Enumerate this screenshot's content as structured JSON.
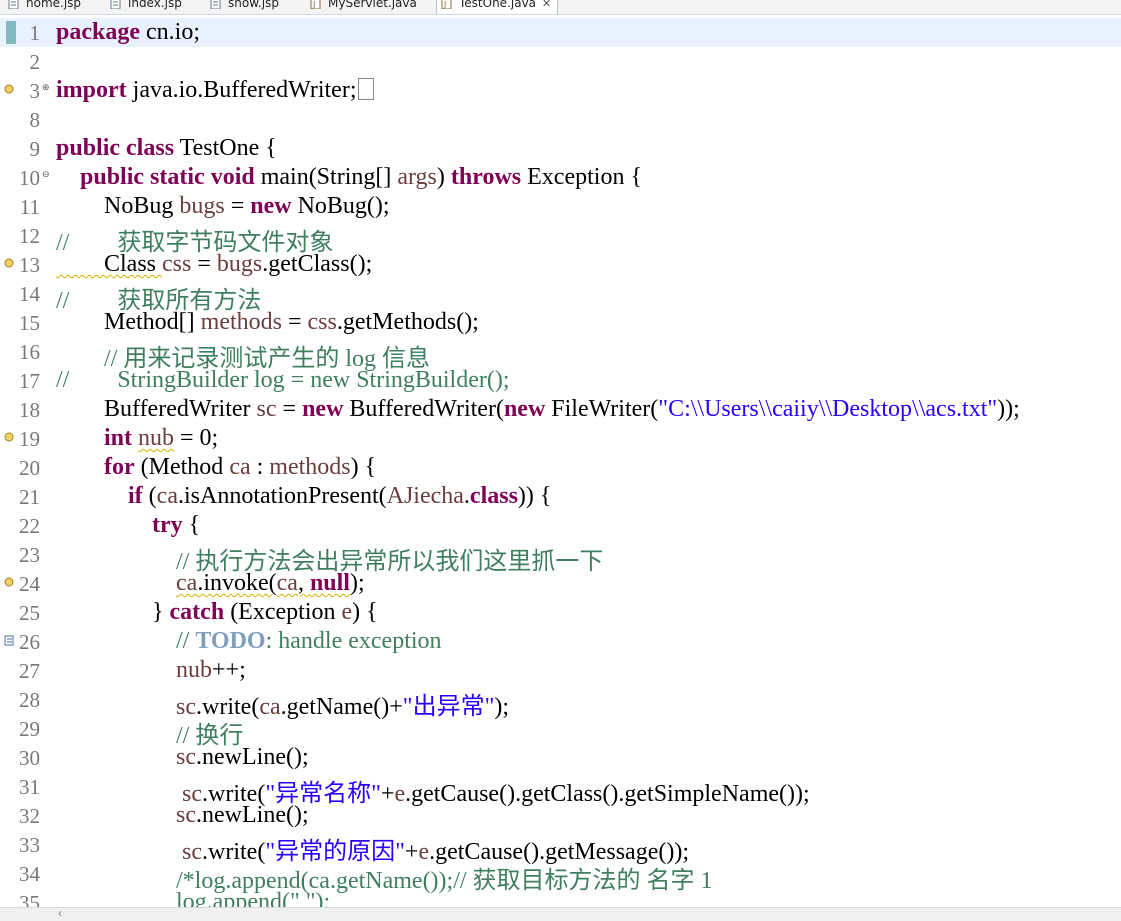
{
  "tabs": [
    {
      "label": "home.jsp",
      "icon": "jsp-file-icon"
    },
    {
      "label": "index.jsp",
      "icon": "jsp-file-icon"
    },
    {
      "label": "show.jsp",
      "icon": "jsp-file-icon"
    },
    {
      "label": "MyServlet.java",
      "icon": "java-file-icon"
    },
    {
      "label": "TestOne.java",
      "icon": "java-file-icon",
      "active": true,
      "close": "✕"
    }
  ],
  "line_numbers": [
    "1",
    "2",
    "3",
    "8",
    "9",
    "10",
    "11",
    "12",
    "13",
    "14",
    "15",
    "16",
    "17",
    "18",
    "19",
    "20",
    "21",
    "22",
    "23",
    "24",
    "25",
    "26",
    "27",
    "28",
    "29",
    "30",
    "31",
    "32",
    "33",
    "34",
    "35"
  ],
  "code": {
    "l1": [
      "package",
      " cn.io;"
    ],
    "l3": [
      "import",
      " java.io.BufferedWriter;"
    ],
    "l9": [
      "public",
      " ",
      "class",
      " TestOne {"
    ],
    "l10": [
      "    ",
      "public",
      " ",
      "static",
      " ",
      "void",
      " main(String[] ",
      "args",
      ") ",
      "throws",
      " Exception {"
    ],
    "l11": [
      "        NoBug ",
      "bugs",
      " = ",
      "new",
      " NoBug();"
    ],
    "l12": "//        获取字节码文件对象",
    "l13": [
      "        Class ",
      "css",
      " = ",
      "bugs",
      ".getClass();"
    ],
    "l14": "//        获取所有方法",
    "l15": [
      "        Method[] ",
      "methods",
      " = ",
      "css",
      ".getMethods();"
    ],
    "l16": "        // 用来记录测试产生的 log 信息",
    "l17": "//        StringBuilder log = new StringBuilder();",
    "l18": [
      "        BufferedWriter ",
      "sc",
      " = ",
      "new",
      " BufferedWriter(",
      "new",
      " FileWriter(",
      "\"C:\\\\Users\\\\caiiy\\\\Desktop\\\\acs.txt\"",
      "));"
    ],
    "l19": [
      "        ",
      "int",
      " ",
      "nub",
      " = 0;"
    ],
    "l20": [
      "        ",
      "for",
      " (Method ",
      "ca",
      " : ",
      "methods",
      ") {"
    ],
    "l21": [
      "            ",
      "if",
      " (",
      "ca",
      ".isAnnotationPresent(",
      "AJiecha",
      ".",
      "class",
      ")) {"
    ],
    "l22": [
      "                ",
      "try",
      " {"
    ],
    "l23": "                    // 执行方法会出异常所以我们这里抓一下",
    "l24": [
      "                    ",
      "ca",
      ".invoke(",
      "ca",
      ", ",
      "null",
      ");"
    ],
    "l25": [
      "                } ",
      "catch",
      " (Exception ",
      "e",
      ") {"
    ],
    "l26": [
      "                    // ",
      "TODO",
      ": handle exception"
    ],
    "l27": [
      "                    ",
      "nub",
      "++;"
    ],
    "l28": [
      "                    ",
      "sc",
      ".write(",
      "ca",
      ".getName()+",
      "\"出异常\"",
      ");"
    ],
    "l29": "                    // 换行",
    "l30": [
      "                    ",
      "sc",
      ".newLine();"
    ],
    "l31": [
      "                     ",
      "sc",
      ".write(",
      "\"异常名称\"",
      "+",
      "e",
      ".getCause().getClass().getSimpleName());"
    ],
    "l32": [
      "                    ",
      "sc",
      ".newLine();"
    ],
    "l33": [
      "                     ",
      "sc",
      ".write(",
      "\"异常的原因\"",
      "+",
      "e",
      ".getCause().getMessage());"
    ],
    "l34": "                    /*log.append(ca.getName());// 获取目标方法的 名字 1",
    "l35": "                    log.append(\" \");"
  },
  "colors": {
    "keyword": "#7f0055",
    "variable": "#6a3e3e",
    "comment": "#3f7f5f",
    "string": "#2a00ff",
    "todo": "#7f9fbf",
    "current_line": "#e8f2fe"
  }
}
